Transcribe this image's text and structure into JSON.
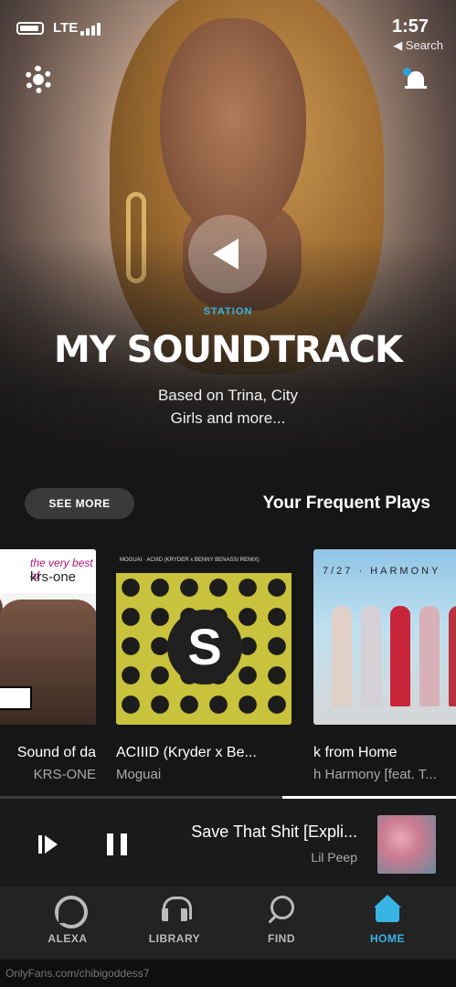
{
  "status_bar": {
    "time": "1:57",
    "network": "LTE",
    "back_link": "◀ Search"
  },
  "hero": {
    "label": "STATION",
    "title": "MY SOUNDTRACK",
    "description_line1": "Based on Trina, City",
    "description_line2": "Girls and more..."
  },
  "frequent": {
    "title": "Your Frequent Plays",
    "see_more": "SEE MORE",
    "items": [
      {
        "title": "k from Home",
        "subtitle": "h Harmony [feat. T...",
        "art_header": "7/27 · HARMONY"
      },
      {
        "title": "ACIIID (Kryder x Be...",
        "subtitle": "Moguai",
        "art_header": "MOGUAI · ACIIID (KRYDER x BENNY BENASSI REMIX)"
      },
      {
        "title": "Sound of da",
        "subtitle": "KRS-ONE",
        "art_tag": "the very best of",
        "art_name": "krs-one"
      }
    ]
  },
  "now_playing": {
    "title": "Save That Shit [Expli...",
    "artist": "Lil Peep"
  },
  "nav": {
    "home": "HOME",
    "find": "FIND",
    "library": "LIBRARY",
    "alexa": "ALEXA"
  },
  "watermark": "OnlyFans.com/chibigoddess7",
  "colors": {
    "accent": "#38b4e4",
    "background": "#161616"
  },
  "icons": [
    "gear-icon",
    "bell-icon",
    "play-icon",
    "pause-icon",
    "previous-icon",
    "home-icon",
    "find-icon",
    "library-icon",
    "alexa-icon"
  ]
}
